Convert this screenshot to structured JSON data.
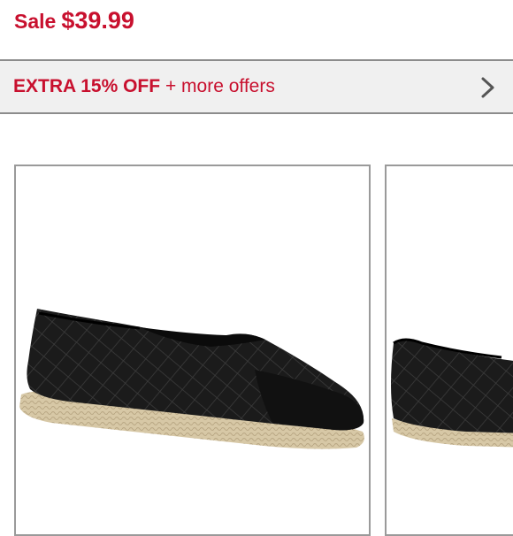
{
  "price": {
    "label": "Sale",
    "value": "$39.99"
  },
  "offers": {
    "highlight": "EXTRA 15% OFF",
    "rest": "+ more offers"
  },
  "products": [
    {
      "image": "black-quilted-espadrille-flat"
    },
    {
      "image": "black-quilted-espadrille-flat-alt-view"
    }
  ],
  "colors": {
    "sale_red": "#c8102e",
    "bar_bg": "#f0f0f0",
    "border": "#9a9a9a"
  }
}
